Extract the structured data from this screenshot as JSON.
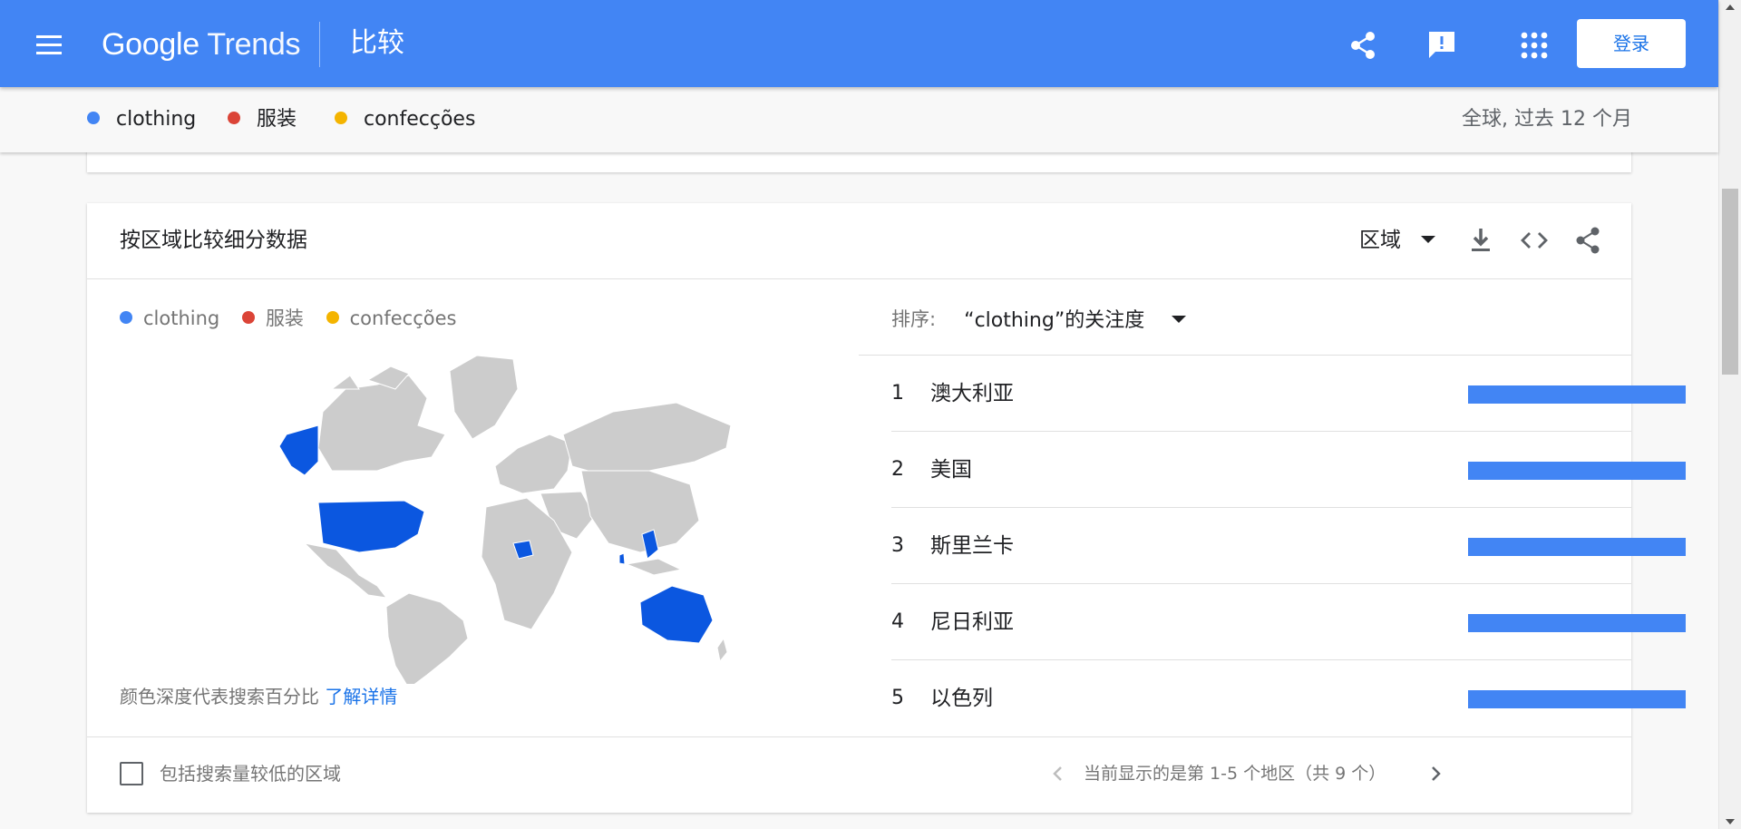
{
  "header": {
    "logo_google": "Google",
    "logo_trends": "Trends",
    "title": "比较",
    "login_label": "登录",
    "icons": [
      "menu-icon",
      "share-icon",
      "feedback-icon",
      "apps-icon"
    ]
  },
  "terms_bar": {
    "terms": [
      {
        "label": "clothing",
        "color": "#4285f4"
      },
      {
        "label": "服装",
        "color": "#db4437"
      },
      {
        "label": "confecções",
        "color": "#f4b400"
      }
    ],
    "meta": "全球, 过去 12 个月"
  },
  "card": {
    "title": "按区域比较细分数据",
    "resolution_label": "区域",
    "icons": [
      "download-icon",
      "embed-code-icon",
      "share-icon"
    ],
    "legend": [
      {
        "label": "clothing",
        "color": "#4285f4"
      },
      {
        "label": "服装",
        "color": "#db4437"
      },
      {
        "label": "confecções",
        "color": "#f4b400"
      }
    ],
    "map_note": "颜色深度代表搜索百分比",
    "map_note_link": "了解详情",
    "sort_label": "排序:",
    "sort_value": "“clothing”的关注度",
    "rankings": [
      {
        "rank": "1",
        "region": "澳大利亚",
        "share": 100
      },
      {
        "rank": "2",
        "region": "美国",
        "share": 100
      },
      {
        "rank": "3",
        "region": "斯里兰卡",
        "share": 100
      },
      {
        "rank": "4",
        "region": "尼日利亚",
        "share": 100
      },
      {
        "rank": "5",
        "region": "以色列",
        "share": 100
      }
    ],
    "include_low_volume_label": "包括搜索量较低的区域",
    "pager_text": "当前显示的是第 1-5 个地区（共 9 个）"
  },
  "colors": {
    "brand_blue": "#4285f4",
    "map_highlight": "#0b57e0",
    "map_land": "#cccccc"
  }
}
